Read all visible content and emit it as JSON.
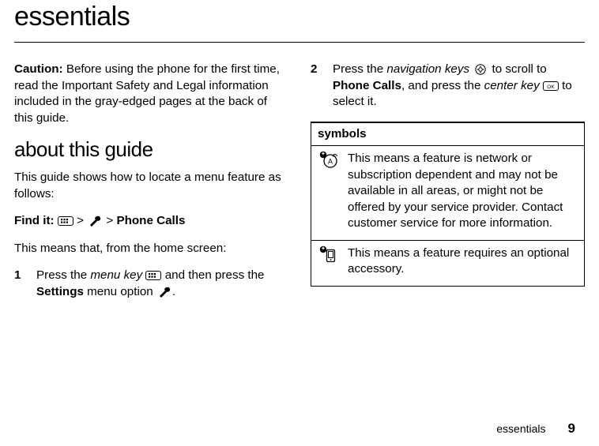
{
  "title": "essentials",
  "left": {
    "caution_label": "Caution:",
    "caution_text": " Before using the phone for the first time, read the Important Safety and Legal information included in the gray-edged pages at the back of this guide.",
    "section_heading": "about this guide",
    "intro": "This guide shows how to locate a menu feature as follows:",
    "findit_label": "Find it:",
    "findit_sep1": " > ",
    "findit_sep2": " > ",
    "findit_tail": "Phone Calls",
    "means": "This means that, from the home screen:",
    "step1_num": "1",
    "step1_a": "Press the ",
    "step1_menu_key": "menu key",
    "step1_b": " and then press the ",
    "step1_settings": "Settings",
    "step1_c": " menu option ",
    "step1_d": "."
  },
  "right": {
    "step2_num": "2",
    "step2_a": "Press the ",
    "step2_navkeys": "navigation keys",
    "step2_b": " to scroll to ",
    "step2_phonecalls": "Phone Calls",
    "step2_c": ", and press the ",
    "step2_centerkey": "center key",
    "step2_d": " to select it.",
    "symbols_header": "symbols",
    "row1": "This means a feature is network or subscription dependent and may not be available in all areas, or might not be offered by your service provider. Contact customer service for more information.",
    "row2": "This means a feature requires an optional accessory."
  },
  "footer": {
    "label": "essentials",
    "page": "9"
  }
}
